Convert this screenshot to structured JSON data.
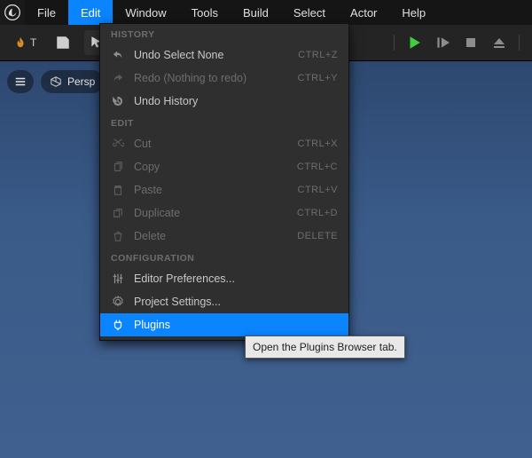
{
  "menu": [
    "File",
    "Edit",
    "Window",
    "Tools",
    "Build",
    "Select",
    "Actor",
    "Help"
  ],
  "activeMenuIndex": 1,
  "viewport": {
    "persp": "Persp"
  },
  "dropdown": {
    "sections": {
      "history": "HISTORY",
      "edit": "EDIT",
      "configuration": "CONFIGURATION"
    },
    "history": [
      {
        "label": "Undo Select None",
        "shortcut": "CTRL+Z",
        "disabled": false,
        "icon": "undo-icon"
      },
      {
        "label": "Redo (Nothing to redo)",
        "shortcut": "CTRL+Y",
        "disabled": true,
        "icon": "redo-icon"
      },
      {
        "label": "Undo History",
        "shortcut": "",
        "disabled": false,
        "icon": "history-icon"
      }
    ],
    "edit": [
      {
        "label": "Cut",
        "shortcut": "CTRL+X",
        "disabled": true,
        "icon": "cut-icon"
      },
      {
        "label": "Copy",
        "shortcut": "CTRL+C",
        "disabled": true,
        "icon": "copy-icon"
      },
      {
        "label": "Paste",
        "shortcut": "CTRL+V",
        "disabled": true,
        "icon": "paste-icon"
      },
      {
        "label": "Duplicate",
        "shortcut": "CTRL+D",
        "disabled": true,
        "icon": "duplicate-icon"
      },
      {
        "label": "Delete",
        "shortcut": "DELETE",
        "disabled": true,
        "icon": "delete-icon"
      }
    ],
    "config": [
      {
        "label": "Editor Preferences...",
        "shortcut": "",
        "disabled": false,
        "icon": "sliders-icon"
      },
      {
        "label": "Project Settings...",
        "shortcut": "",
        "disabled": false,
        "icon": "gear-icon"
      },
      {
        "label": "Plugins",
        "shortcut": "",
        "disabled": false,
        "icon": "plug-icon",
        "highlight": true
      }
    ]
  },
  "tooltip": "Open the Plugins Browser tab."
}
